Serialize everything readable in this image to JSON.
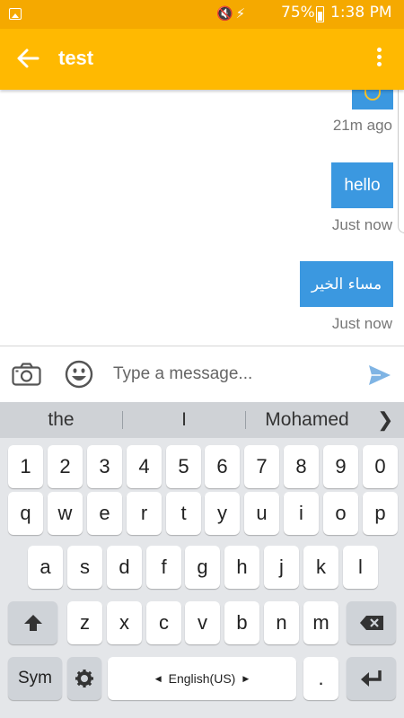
{
  "status_bar": {
    "icons": "🔇⚡",
    "battery": "75%",
    "time": "1:38 PM"
  },
  "app_bar": {
    "title": "test"
  },
  "chat": {
    "messages": [
      {
        "text": "",
        "time": "21m ago"
      },
      {
        "text": "hello",
        "time": "Just now"
      },
      {
        "text": "مساء الخير",
        "time": "Just now"
      }
    ],
    "bubble_color": "#3b98e0"
  },
  "composer": {
    "placeholder": "Type a message..."
  },
  "suggestions": [
    "the",
    "I",
    "Mohamed"
  ],
  "keyboard": {
    "row_numbers": [
      "1",
      "2",
      "3",
      "4",
      "5",
      "6",
      "7",
      "8",
      "9",
      "0"
    ],
    "row_top": [
      "q",
      "w",
      "e",
      "r",
      "t",
      "y",
      "u",
      "i",
      "o",
      "p"
    ],
    "row_home": [
      "a",
      "s",
      "d",
      "f",
      "g",
      "h",
      "j",
      "k",
      "l"
    ],
    "row_bottom": [
      "z",
      "x",
      "c",
      "v",
      "b",
      "n",
      "m"
    ],
    "sym_label": "Sym",
    "space_label": "English(US)",
    "period_label": "."
  },
  "colors": {
    "status_bar": "#f5a900",
    "app_bar": "#ffb901",
    "send_icon": "#3b98e0"
  }
}
